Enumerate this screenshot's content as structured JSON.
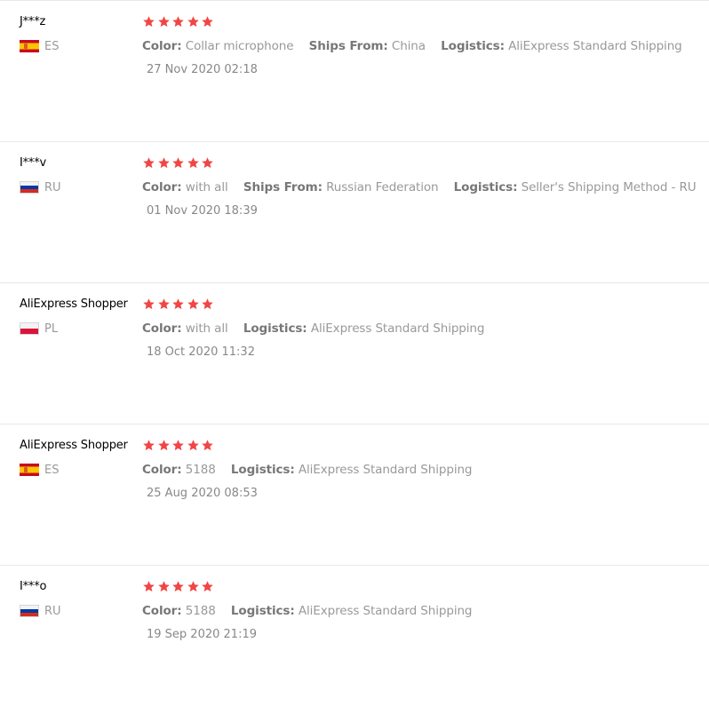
{
  "reviews": [
    {
      "buyer": "J***z",
      "country": "ES",
      "flag": "spain-flag-icon",
      "rating": 5,
      "details": [
        {
          "label": "Color:",
          "value": "Collar microphone"
        },
        {
          "label": "Ships From:",
          "value": "China"
        },
        {
          "label": "Logistics:",
          "value": "AliExpress Standard Shipping"
        }
      ],
      "date": "27 Nov 2020 02:18"
    },
    {
      "buyer": "I***v",
      "country": "RU",
      "flag": "russia-flag-icon",
      "rating": 5,
      "details": [
        {
          "label": "Color:",
          "value": "with all"
        },
        {
          "label": "Ships From:",
          "value": "Russian Federation"
        },
        {
          "label": "Logistics:",
          "value": "Seller's Shipping Method - RU"
        }
      ],
      "date": "01 Nov 2020 18:39"
    },
    {
      "buyer": "AliExpress Shopper",
      "country": "PL",
      "flag": "poland-flag-icon",
      "rating": 5,
      "details": [
        {
          "label": "Color:",
          "value": "with all"
        },
        {
          "label": "Logistics:",
          "value": "AliExpress Standard Shipping"
        }
      ],
      "date": "18 Oct 2020 11:32"
    },
    {
      "buyer": "AliExpress Shopper",
      "country": "ES",
      "flag": "spain-flag-icon",
      "rating": 5,
      "details": [
        {
          "label": "Color:",
          "value": "5188"
        },
        {
          "label": "Logistics:",
          "value": "AliExpress Standard Shipping"
        }
      ],
      "date": "25 Aug 2020 08:53"
    },
    {
      "buyer": "I***o",
      "country": "RU",
      "flag": "russia-flag-icon",
      "rating": 5,
      "details": [
        {
          "label": "Color:",
          "value": "5188"
        },
        {
          "label": "Logistics:",
          "value": "AliExpress Standard Shipping"
        }
      ],
      "date": "19 Sep 2020 21:19"
    }
  ],
  "colors": {
    "star": "#f04645",
    "label": "#777777",
    "value": "#999999",
    "divider": "#e8e8e8"
  }
}
